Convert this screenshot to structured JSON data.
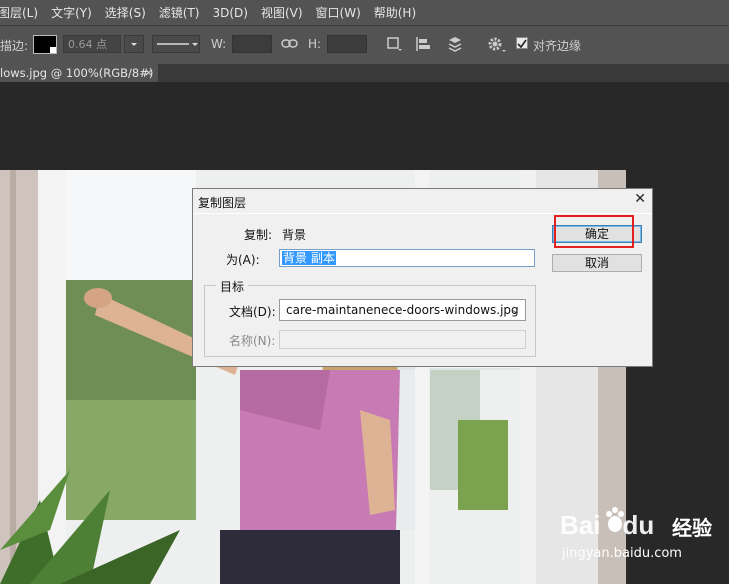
{
  "menu": [
    "图层(L)",
    "文字(Y)",
    "选择(S)",
    "滤镜(T)",
    "3D(D)",
    "视图(V)",
    "窗口(W)",
    "帮助(H)"
  ],
  "options": {
    "stroke_label": "描边:",
    "stroke_size": "0.64 点",
    "w_label": "W:",
    "h_label": "H:",
    "align_edges_label": "对齐边缘",
    "align_edges_checked": true
  },
  "tab": {
    "title": "lows.jpg @ 100%(RGB/8#)",
    "close": "×"
  },
  "dialog": {
    "title": "复制图层",
    "close": "✕",
    "copy_label": "复制:",
    "copy_value": "背景",
    "as_label": "为(A):",
    "as_value": "背景 副本",
    "target_group": "目标",
    "document_label": "文档(D):",
    "document_value": "care-maintanenece-doors-windows.jpg",
    "name_label": "名称(N):",
    "ok_label": "确定",
    "cancel_label": "取消"
  },
  "watermark": {
    "brand": "Bai",
    "brand2": "du",
    "cn": "经验",
    "url": "jingyan.baidu.com"
  },
  "colors": {
    "highlight_box": "#e0211f",
    "selection": "#3399ff"
  }
}
